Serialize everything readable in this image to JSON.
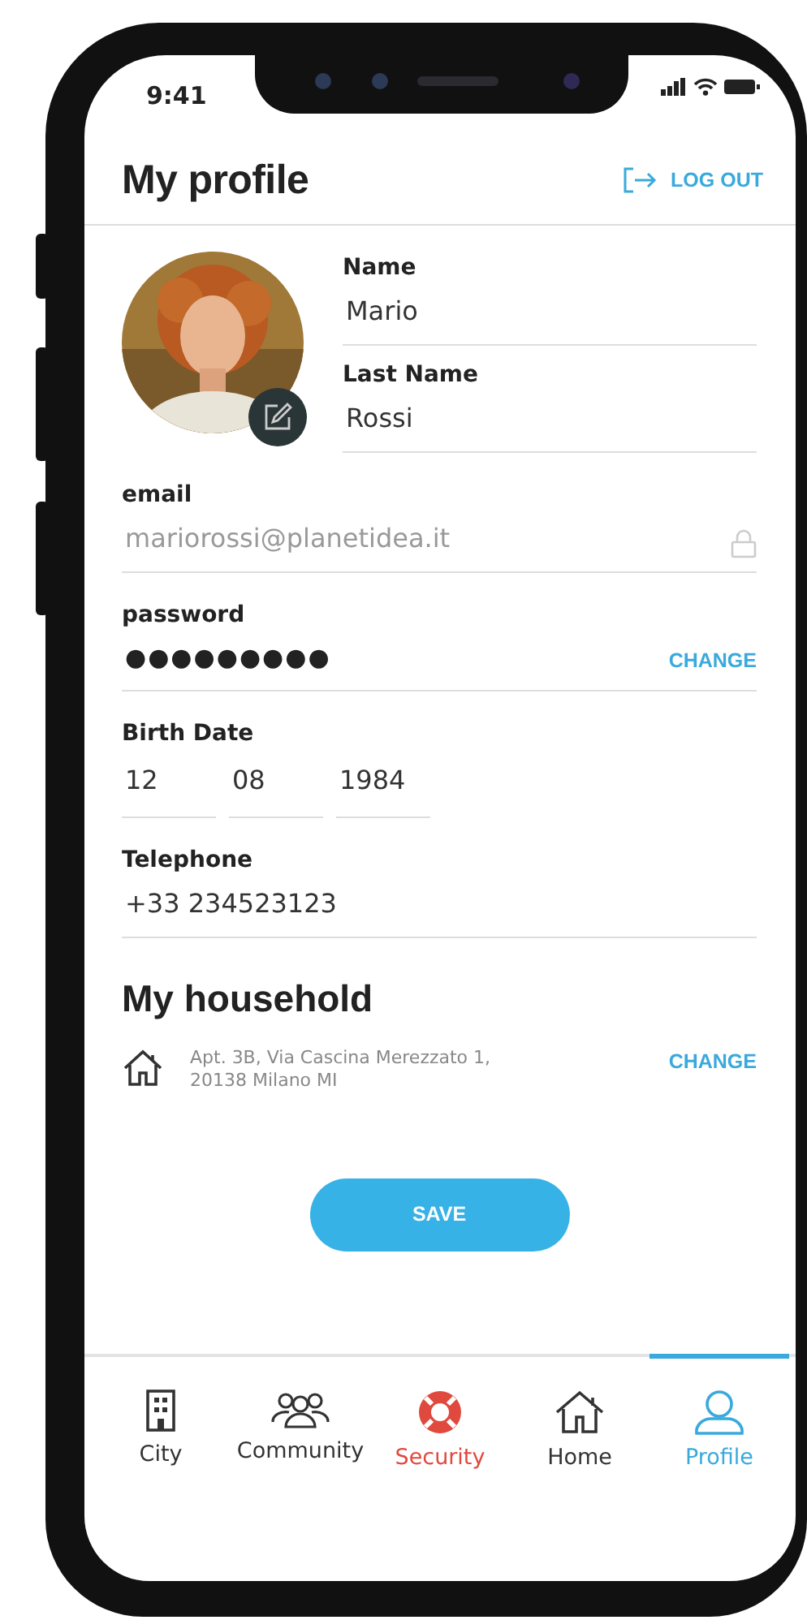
{
  "status_bar": {
    "time": "9:41"
  },
  "header": {
    "title": "My profile",
    "action": "LOG OUT"
  },
  "profile": {
    "fields": [
      {
        "label": "Name",
        "value": "Mario"
      },
      {
        "label": "Last Name",
        "value": "Rossi"
      }
    ]
  },
  "account": [
    {
      "label": "email",
      "value": "mariorossi@planetidea.it",
      "kind": "locked"
    },
    {
      "label": "password",
      "value": "●●●●●●●●●",
      "kind": "change",
      "action": "CHANGE"
    }
  ],
  "birth_date": {
    "label": "Birth Date",
    "parts": [
      "12",
      "08",
      "1984"
    ]
  },
  "telephone": {
    "label": "Telephone",
    "value": "+33 234523123"
  },
  "household": {
    "title": "My household",
    "address_lines": [
      "Apt. 3B, Via Cascina Merezzato 1,",
      "20138 Milano MI"
    ],
    "action": "CHANGE"
  },
  "save_button": "SAVE",
  "tabs": [
    {
      "label": "City",
      "kind": "city",
      "selected": false,
      "color": "#333333"
    },
    {
      "label": "Community",
      "kind": "community",
      "selected": false,
      "color": "#333333"
    },
    {
      "label": "Security",
      "kind": "security",
      "selected": false,
      "color": "#e0493e"
    },
    {
      "label": "Home",
      "kind": "home",
      "selected": false,
      "color": "#333333"
    },
    {
      "label": "Profile",
      "kind": "profile",
      "selected": true,
      "color": "#3aa9dc"
    }
  ]
}
